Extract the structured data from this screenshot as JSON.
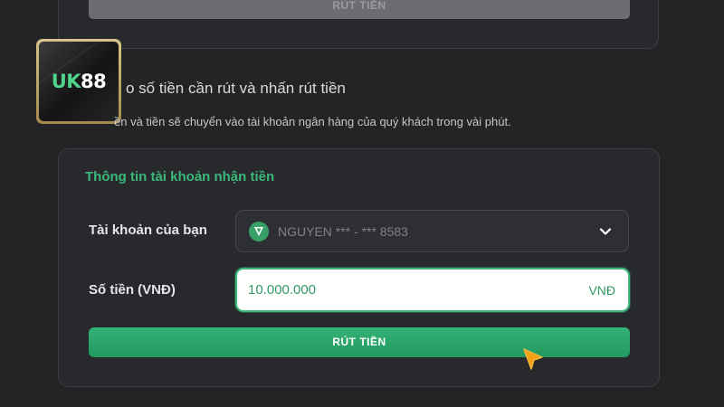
{
  "top_card": {
    "button_label": "RÚT TIỀN"
  },
  "logo": {
    "brand_prefix": "UK",
    "brand_suffix": "88"
  },
  "step": {
    "title": "o số tiền cần rút và nhấn rút tiền",
    "description": "ền và tiền sẽ chuyển vào tài khoản ngân hàng của quý khách trong vài phút."
  },
  "form": {
    "section_title": "Thông tin tài khoản nhận tiền",
    "account_label": "Tài khoản của bạn",
    "account_value": "NGUYEN *** - *** 8583",
    "amount_label": "Số tiền (VNĐ)",
    "amount_value": "10.000.000",
    "amount_unit": "VNĐ",
    "submit_label": "RÚT TIỀN"
  },
  "colors": {
    "accent": "#3bb87a",
    "background": "#232426",
    "card": "#27292c"
  },
  "icons": {
    "bank": "bank-shield-icon",
    "dropdown": "chevron-down-icon",
    "pointer": "cursor-pointer-icon"
  }
}
